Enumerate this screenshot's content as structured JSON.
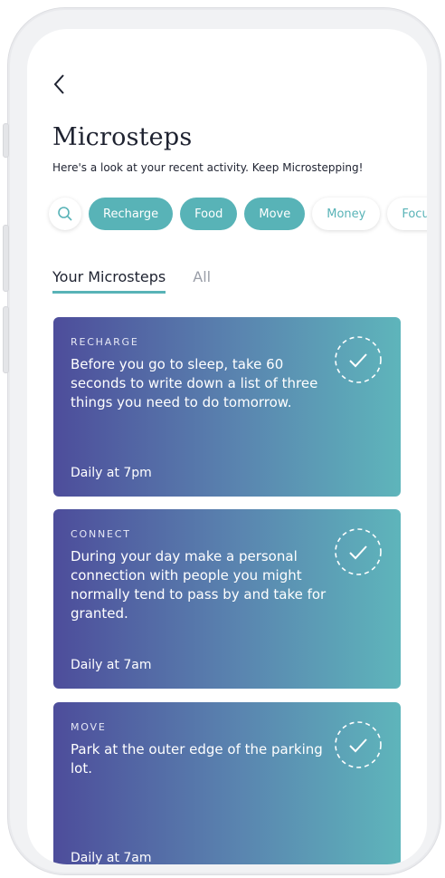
{
  "header": {
    "back_icon": "chevron-left-icon",
    "title": "Microsteps",
    "subtitle": "Here's a look at your recent activity. Keep Microstepping!"
  },
  "filters": {
    "search_icon": "search-icon",
    "chips": [
      {
        "label": "Recharge",
        "active": true
      },
      {
        "label": "Food",
        "active": true
      },
      {
        "label": "Move",
        "active": true
      },
      {
        "label": "Money",
        "active": false
      },
      {
        "label": "Focus",
        "active": false
      }
    ]
  },
  "tabs": [
    {
      "label": "Your Microsteps",
      "active": true
    },
    {
      "label": "All",
      "active": false
    }
  ],
  "cards": [
    {
      "category": "RECHARGE",
      "text": "Before you go to sleep, take 60 seconds to write down a list of three things you need to do tomorrow.",
      "time": "Daily at 7pm",
      "icon": "check-circle-icon"
    },
    {
      "category": "CONNECT",
      "text": "During your day make a personal connection with people you might normally tend to pass by and take for granted.",
      "time": "Daily at 7am",
      "icon": "check-circle-icon"
    },
    {
      "category": "MOVE",
      "text": "Park at the outer edge of the parking lot.",
      "time": "Daily at 7am",
      "icon": "check-circle-icon"
    }
  ],
  "colors": {
    "accent": "#58b3b7",
    "gradient_start": "#4d4d9b",
    "gradient_end": "#5eb5bb",
    "text_dark": "#1e2230"
  }
}
